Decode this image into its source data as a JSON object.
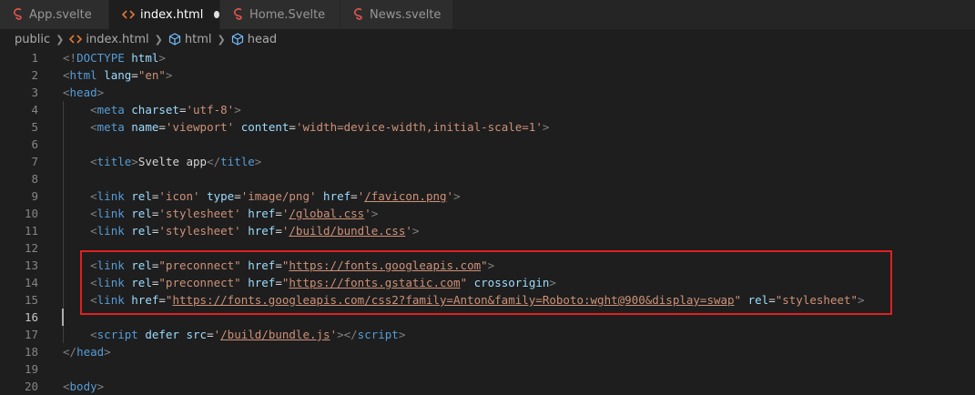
{
  "tabs": [
    {
      "label": "App.svelte",
      "icon": "svelte-icon",
      "active": false
    },
    {
      "label": "index.html",
      "icon": "html-icon",
      "active": true,
      "dirty": true
    },
    {
      "label": "Home.Svelte",
      "icon": "svelte-icon",
      "active": false
    },
    {
      "label": "News.svelte",
      "icon": "svelte-icon",
      "active": false
    }
  ],
  "breadcrumb": [
    "public",
    "index.html",
    "html",
    "head"
  ],
  "colors": {
    "tag": "#569cd6",
    "attr": "#9cdcfe",
    "string": "#ce9178",
    "punct": "#808080",
    "highlight": "#e02020"
  },
  "current_line": 16,
  "lines": [
    {
      "n": "1",
      "tokens": [
        [
          "t",
          "<!"
        ],
        [
          "tag",
          "DOCTYPE"
        ],
        [
          "txt",
          " "
        ],
        [
          "attr",
          "html"
        ],
        [
          "t",
          ">"
        ]
      ]
    },
    {
      "n": "2",
      "tokens": [
        [
          "t",
          "<"
        ],
        [
          "tag",
          "html"
        ],
        [
          "txt",
          " "
        ],
        [
          "attr",
          "lang"
        ],
        [
          "txt",
          "="
        ],
        [
          "str",
          "\"en\""
        ],
        [
          "t",
          ">"
        ]
      ]
    },
    {
      "n": "3",
      "tokens": [
        [
          "t",
          "<"
        ],
        [
          "tag",
          "head"
        ],
        [
          "t",
          ">"
        ]
      ]
    },
    {
      "n": "4",
      "tokens": [
        [
          "txt",
          "    "
        ],
        [
          "t",
          "<"
        ],
        [
          "tag",
          "meta"
        ],
        [
          "txt",
          " "
        ],
        [
          "attr",
          "charset"
        ],
        [
          "txt",
          "="
        ],
        [
          "str",
          "'utf-8'"
        ],
        [
          "t",
          ">"
        ]
      ]
    },
    {
      "n": "5",
      "tokens": [
        [
          "txt",
          "    "
        ],
        [
          "t",
          "<"
        ],
        [
          "tag",
          "meta"
        ],
        [
          "txt",
          " "
        ],
        [
          "attr",
          "name"
        ],
        [
          "txt",
          "="
        ],
        [
          "str",
          "'viewport'"
        ],
        [
          "txt",
          " "
        ],
        [
          "attr",
          "content"
        ],
        [
          "txt",
          "="
        ],
        [
          "str",
          "'width=device-width,initial-scale=1'"
        ],
        [
          "t",
          ">"
        ]
      ]
    },
    {
      "n": "6",
      "tokens": []
    },
    {
      "n": "7",
      "tokens": [
        [
          "txt",
          "    "
        ],
        [
          "t",
          "<"
        ],
        [
          "tag",
          "title"
        ],
        [
          "t",
          ">"
        ],
        [
          "txt",
          "Svelte app"
        ],
        [
          "t",
          "</"
        ],
        [
          "tag",
          "title"
        ],
        [
          "t",
          ">"
        ]
      ]
    },
    {
      "n": "8",
      "tokens": []
    },
    {
      "n": "9",
      "tokens": [
        [
          "txt",
          "    "
        ],
        [
          "t",
          "<"
        ],
        [
          "tag",
          "link"
        ],
        [
          "txt",
          " "
        ],
        [
          "attr",
          "rel"
        ],
        [
          "txt",
          "="
        ],
        [
          "str",
          "'icon'"
        ],
        [
          "txt",
          " "
        ],
        [
          "attr",
          "type"
        ],
        [
          "txt",
          "="
        ],
        [
          "str",
          "'image/png'"
        ],
        [
          "txt",
          " "
        ],
        [
          "attr",
          "href"
        ],
        [
          "txt",
          "="
        ],
        [
          "str",
          "'"
        ],
        [
          "url",
          "/favicon.png"
        ],
        [
          "str",
          "'"
        ],
        [
          "t",
          ">"
        ]
      ]
    },
    {
      "n": "10",
      "tokens": [
        [
          "txt",
          "    "
        ],
        [
          "t",
          "<"
        ],
        [
          "tag",
          "link"
        ],
        [
          "txt",
          " "
        ],
        [
          "attr",
          "rel"
        ],
        [
          "txt",
          "="
        ],
        [
          "str",
          "'stylesheet'"
        ],
        [
          "txt",
          " "
        ],
        [
          "attr",
          "href"
        ],
        [
          "txt",
          "="
        ],
        [
          "str",
          "'"
        ],
        [
          "url",
          "/global.css"
        ],
        [
          "str",
          "'"
        ],
        [
          "t",
          ">"
        ]
      ]
    },
    {
      "n": "11",
      "tokens": [
        [
          "txt",
          "    "
        ],
        [
          "t",
          "<"
        ],
        [
          "tag",
          "link"
        ],
        [
          "txt",
          " "
        ],
        [
          "attr",
          "rel"
        ],
        [
          "txt",
          "="
        ],
        [
          "str",
          "'stylesheet'"
        ],
        [
          "txt",
          " "
        ],
        [
          "attr",
          "href"
        ],
        [
          "txt",
          "="
        ],
        [
          "str",
          "'"
        ],
        [
          "url",
          "/build/bundle.css"
        ],
        [
          "str",
          "'"
        ],
        [
          "t",
          ">"
        ]
      ]
    },
    {
      "n": "12",
      "tokens": []
    },
    {
      "n": "13",
      "tokens": [
        [
          "txt",
          "    "
        ],
        [
          "t",
          "<"
        ],
        [
          "tag",
          "link"
        ],
        [
          "txt",
          " "
        ],
        [
          "attr",
          "rel"
        ],
        [
          "txt",
          "="
        ],
        [
          "str",
          "\"preconnect\""
        ],
        [
          "txt",
          " "
        ],
        [
          "attr",
          "href"
        ],
        [
          "txt",
          "="
        ],
        [
          "str",
          "\""
        ],
        [
          "url",
          "https://fonts.googleapis.com"
        ],
        [
          "str",
          "\""
        ],
        [
          "t",
          ">"
        ]
      ]
    },
    {
      "n": "14",
      "tokens": [
        [
          "txt",
          "    "
        ],
        [
          "t",
          "<"
        ],
        [
          "tag",
          "link"
        ],
        [
          "txt",
          " "
        ],
        [
          "attr",
          "rel"
        ],
        [
          "txt",
          "="
        ],
        [
          "str",
          "\"preconnect\""
        ],
        [
          "txt",
          " "
        ],
        [
          "attr",
          "href"
        ],
        [
          "txt",
          "="
        ],
        [
          "str",
          "\""
        ],
        [
          "url",
          "https://fonts.gstatic.com"
        ],
        [
          "str",
          "\""
        ],
        [
          "txt",
          " "
        ],
        [
          "attr",
          "crossorigin"
        ],
        [
          "t",
          ">"
        ]
      ]
    },
    {
      "n": "15",
      "tokens": [
        [
          "txt",
          "    "
        ],
        [
          "t",
          "<"
        ],
        [
          "tag",
          "link"
        ],
        [
          "txt",
          " "
        ],
        [
          "attr",
          "href"
        ],
        [
          "txt",
          "="
        ],
        [
          "str",
          "\""
        ],
        [
          "url",
          "https://fonts.googleapis.com/css2?family=Anton&family=Roboto:wght@900&display=swap"
        ],
        [
          "str",
          "\""
        ],
        [
          "txt",
          " "
        ],
        [
          "attr",
          "rel"
        ],
        [
          "txt",
          "="
        ],
        [
          "str",
          "\"stylesheet\""
        ],
        [
          "t",
          ">"
        ]
      ]
    },
    {
      "n": "16",
      "tokens": []
    },
    {
      "n": "17",
      "tokens": [
        [
          "txt",
          "    "
        ],
        [
          "t",
          "<"
        ],
        [
          "tag",
          "script"
        ],
        [
          "txt",
          " "
        ],
        [
          "attr",
          "defer"
        ],
        [
          "txt",
          " "
        ],
        [
          "attr",
          "src"
        ],
        [
          "txt",
          "="
        ],
        [
          "str",
          "'"
        ],
        [
          "url",
          "/build/bundle.js"
        ],
        [
          "str",
          "'"
        ],
        [
          "t",
          "></"
        ],
        [
          "tag",
          "script"
        ],
        [
          "t",
          ">"
        ]
      ]
    },
    {
      "n": "18",
      "tokens": [
        [
          "t",
          "</"
        ],
        [
          "tag",
          "head"
        ],
        [
          "t",
          ">"
        ]
      ]
    },
    {
      "n": "19",
      "tokens": []
    },
    {
      "n": "20",
      "tokens": [
        [
          "t",
          "<"
        ],
        [
          "tag",
          "body"
        ],
        [
          "t",
          ">"
        ]
      ]
    }
  ]
}
